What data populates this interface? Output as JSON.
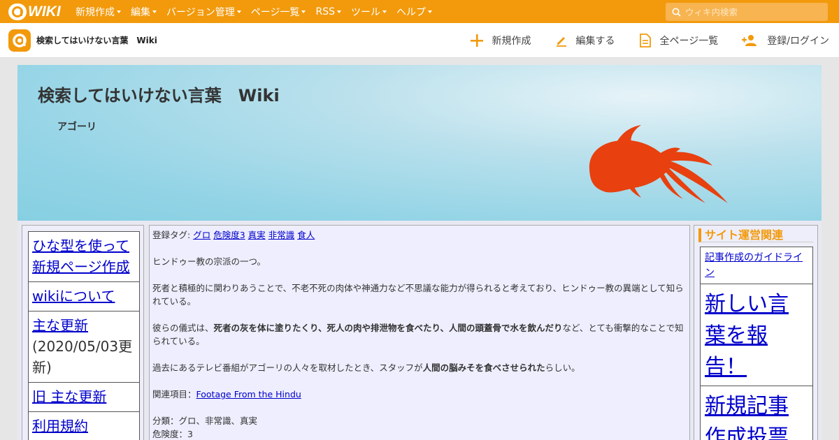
{
  "topbar": {
    "logo_text": "WIKI",
    "menu": [
      "新規作成",
      "編集",
      "バージョン管理",
      "ページ一覧",
      "RSS",
      "ツール",
      "ヘルプ"
    ],
    "search_placeholder": "ウィキ内検索"
  },
  "subbar": {
    "site_name": "検索してはいけない言葉　Wiki",
    "actions": [
      "新規作成",
      "編集する",
      "全ページ一覧",
      "登録/ログイン"
    ]
  },
  "banner": {
    "title": "検索してはいけない言葉　Wiki",
    "subtitle": "アゴーリ"
  },
  "left_nav": [
    {
      "label": "ひな型を使って新規ページ作成"
    },
    {
      "label": "wikiについて"
    },
    {
      "label": "主な更新",
      "note": "(2020/05/03更新)"
    },
    {
      "label": "旧 主な更新"
    },
    {
      "label": "利用規約"
    }
  ],
  "article": {
    "tags_label": "登録タグ:",
    "tags": [
      "グロ",
      "危険度3",
      "真実",
      "非常識",
      "食人"
    ],
    "p1": "ヒンドゥー教の宗派の一つ。",
    "p2": "死者と積極的に関わりあうことで、不老不死の肉体や神通力など不思議な能力が得られると考えており、ヒンドゥー教の異端として知られている。",
    "p3_pre": "彼らの儀式は、",
    "p3_bold": "死者の灰を体に塗りたくり、死人の肉や排泄物を食べたり、人間の頭蓋骨で水を飲んだり",
    "p3_post": "など、とても衝撃的なことで知られている。",
    "p4_pre": "過去にあるテレビ番組がアゴーリの人々を取材したとき、スタッフが",
    "p4_bold": "人間の脳みそを食べさせられた",
    "p4_post": "らしい。",
    "related_label": "関連項目：",
    "related_link": "Footage From the Hindu",
    "category": "分類：グロ、非常識、真実",
    "danger": "危険度：3"
  },
  "right_nav": {
    "heading": "サイト運営関連",
    "items": [
      "記事作成のガイドライン",
      "新しい言葉を報告！",
      "新規記事作成投票"
    ]
  },
  "colors": {
    "brand_orange": "#f29a0c",
    "link_blue": "#0000cc",
    "fish": "#e8400f"
  }
}
